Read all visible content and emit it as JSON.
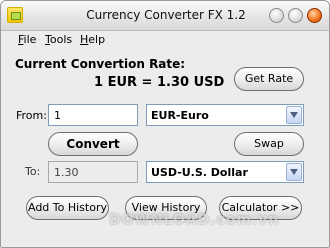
{
  "window": {
    "title": "Currency Converter FX 1.2",
    "buttons": [
      "minimize",
      "maximize",
      "close"
    ]
  },
  "menu": [
    {
      "label": "File"
    },
    {
      "label": "Tools"
    },
    {
      "label": "Help"
    }
  ],
  "rate": {
    "label": "Current Convertion Rate:",
    "value": "1 EUR = 1.30 USD",
    "get_rate_label": "Get Rate"
  },
  "from": {
    "label": "From:",
    "amount": "1",
    "currency": "EUR-Euro"
  },
  "convert_label": "Convert",
  "swap_label": "Swap",
  "to": {
    "label": "To:",
    "amount": "1.30",
    "currency": "USD-U.S. Dollar"
  },
  "bottom_buttons": {
    "add_history": "Add To History",
    "view_history": "View History",
    "calculator": "Calculator >>"
  },
  "watermark": "DOWNLOAD.com.vn"
}
